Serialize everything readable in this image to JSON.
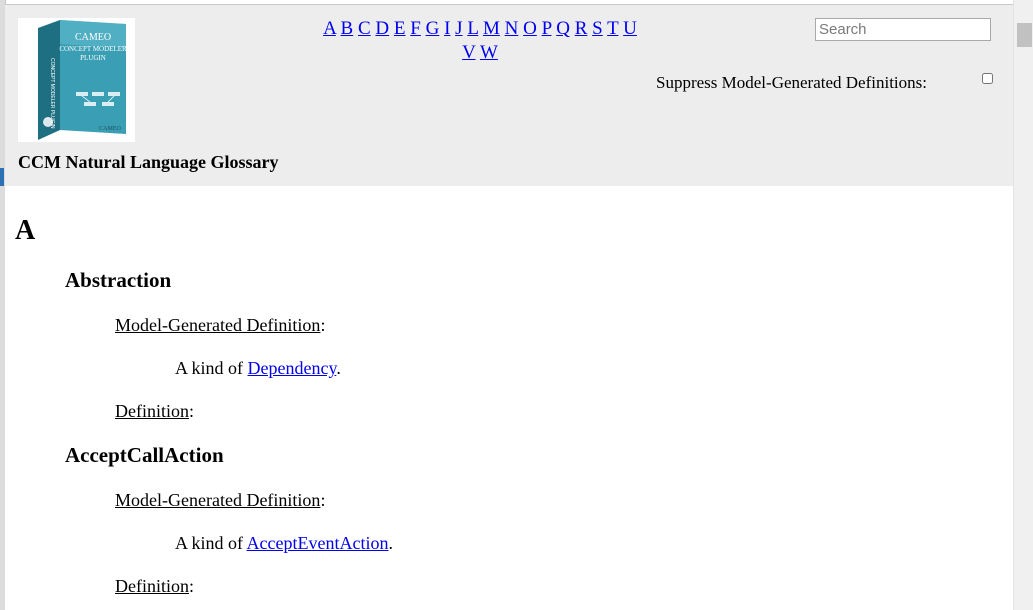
{
  "header": {
    "logo": {
      "brand": "CAMEO",
      "product_line1": "CONCEPT MODELER",
      "product_line2": "PLUGIN",
      "spine_text": "CONCEPT MODELER PLUGIN"
    },
    "title": "CCM Natural Language Glossary",
    "alphabet": [
      "A",
      "B",
      "C",
      "D",
      "E",
      "F",
      "G",
      "I",
      "J",
      "L",
      "M",
      "N",
      "O",
      "P",
      "Q",
      "R",
      "S",
      "T",
      "U",
      "V",
      "W"
    ],
    "search_placeholder": "Search",
    "suppress_label": "Suppress Model-Generated Definitions:",
    "suppress_checked": false
  },
  "content": {
    "letter": "A",
    "entries": [
      {
        "term": "Abstraction",
        "model_label": "Model-Generated Definition",
        "model_prefix": "A kind of",
        "model_link": "Dependency",
        "model_suffix": ".",
        "def_label": "Definition"
      },
      {
        "term": "AcceptCallAction",
        "model_label": "Model-Generated Definition",
        "model_prefix": "A kind of",
        "model_link": "AcceptEventAction",
        "model_suffix": ".",
        "def_label": "Definition"
      }
    ]
  },
  "colors": {
    "link": "#0000ee",
    "header_bg": "#ededed",
    "logo_box": "#2a8ea3"
  }
}
